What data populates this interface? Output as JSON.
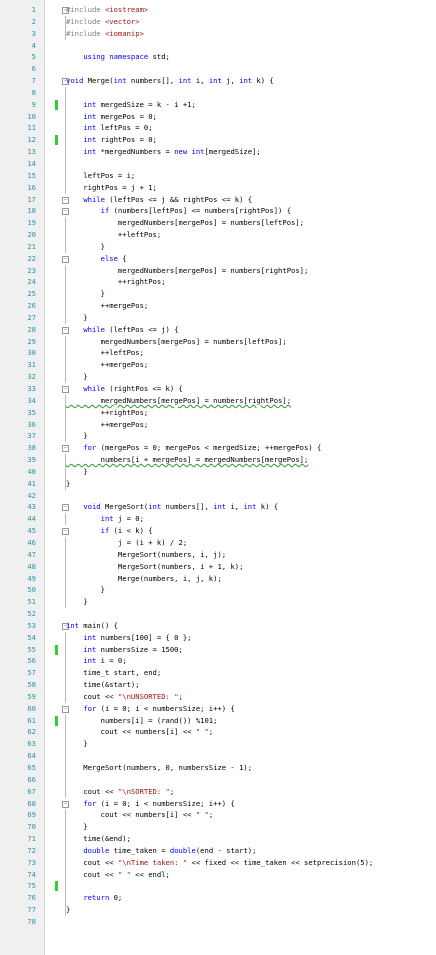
{
  "editor": {
    "lines": [
      {
        "n": "1",
        "text": "#include <iostream>",
        "fold": "open"
      },
      {
        "n": "2",
        "text": "#include <vector>",
        "bar": true
      },
      {
        "n": "3",
        "text": "#include <iomanip>",
        "bar": true
      },
      {
        "n": "4",
        "text": ""
      },
      {
        "n": "5",
        "text": "    using namespace std;"
      },
      {
        "n": "6",
        "text": ""
      },
      {
        "n": "7",
        "text": "void Merge(int numbers[], int i, int j, int k) {",
        "fold": "open"
      },
      {
        "n": "8",
        "text": "",
        "bar": true
      },
      {
        "n": "9",
        "text": "    int mergedSize = k - i +1;",
        "bar": true,
        "changed": true
      },
      {
        "n": "10",
        "text": "    int mergePos = 0;",
        "bar": true
      },
      {
        "n": "11",
        "text": "    int leftPos = 0;",
        "bar": true
      },
      {
        "n": "12",
        "text": "    int rightPos = 0;",
        "bar": true,
        "changed": true
      },
      {
        "n": "13",
        "text": "    int *mergedNumbers = new int[mergedSize];",
        "bar": true
      },
      {
        "n": "14",
        "text": "",
        "bar": true
      },
      {
        "n": "15",
        "text": "    leftPos = i;",
        "bar": true
      },
      {
        "n": "16",
        "text": "    rightPos = j + 1;",
        "bar": true
      },
      {
        "n": "17",
        "text": "    while (leftPos <= j && rightPos <= k) {",
        "fold": "open"
      },
      {
        "n": "18",
        "text": "        if (numbers[leftPos] <= numbers[rightPos]) {",
        "fold": "open"
      },
      {
        "n": "19",
        "text": "            mergedNumbers[mergePos] = numbers[leftPos];",
        "bar": true
      },
      {
        "n": "20",
        "text": "            ++leftPos;",
        "bar": true
      },
      {
        "n": "21",
        "text": "        }",
        "bar": true
      },
      {
        "n": "22",
        "text": "        else {",
        "fold": "open"
      },
      {
        "n": "23",
        "text": "            mergedNumbers[mergePos] = numbers[rightPos];",
        "bar": true
      },
      {
        "n": "24",
        "text": "            ++rightPos;",
        "bar": true
      },
      {
        "n": "25",
        "text": "        }",
        "bar": true
      },
      {
        "n": "26",
        "text": "        ++mergePos;",
        "bar": true
      },
      {
        "n": "27",
        "text": "    }",
        "bar": true
      },
      {
        "n": "28",
        "text": "    while (leftPos <= j) {",
        "fold": "open"
      },
      {
        "n": "29",
        "text": "        mergedNumbers[mergePos] = numbers[leftPos];",
        "bar": true
      },
      {
        "n": "30",
        "text": "        ++leftPos;",
        "bar": true
      },
      {
        "n": "31",
        "text": "        ++mergePos;",
        "bar": true
      },
      {
        "n": "32",
        "text": "    }",
        "bar": true
      },
      {
        "n": "33",
        "text": "    while (rightPos <= k) {",
        "fold": "open"
      },
      {
        "n": "34",
        "text": "        mergedNumbers[mergePos] = numbers[rightPos];",
        "bar": true,
        "squiggle": true
      },
      {
        "n": "35",
        "text": "        ++rightPos;",
        "bar": true
      },
      {
        "n": "36",
        "text": "        ++mergePos;",
        "bar": true
      },
      {
        "n": "37",
        "text": "    }",
        "bar": true
      },
      {
        "n": "38",
        "text": "    for (mergePos = 0; mergePos < mergedSize; ++mergePos) {",
        "fold": "open"
      },
      {
        "n": "39",
        "text": "        numbers[i + mergePos] = mergedNumbers[mergePos];",
        "bar": true,
        "squiggle": true
      },
      {
        "n": "40",
        "text": "    }",
        "bar": true
      },
      {
        "n": "41",
        "text": "}",
        "bar": true
      },
      {
        "n": "42",
        "text": ""
      },
      {
        "n": "43",
        "text": "    void MergeSort(int numbers[], int i, int k) {",
        "fold": "open"
      },
      {
        "n": "44",
        "text": "        int j = 0;",
        "bar": true
      },
      {
        "n": "45",
        "text": "        if (i < k) {",
        "fold": "open"
      },
      {
        "n": "46",
        "text": "            j = (i + k) / 2;",
        "bar": true
      },
      {
        "n": "47",
        "text": "            MergeSort(numbers, i, j);",
        "bar": true
      },
      {
        "n": "48",
        "text": "            MergeSort(numbers, i + 1, k);",
        "bar": true
      },
      {
        "n": "49",
        "text": "            Merge(numbers, i, j, k);",
        "bar": true
      },
      {
        "n": "50",
        "text": "        }",
        "bar": true
      },
      {
        "n": "51",
        "text": "    }",
        "bar": true
      },
      {
        "n": "52",
        "text": ""
      },
      {
        "n": "53",
        "text": "int main() {",
        "fold": "open"
      },
      {
        "n": "54",
        "text": "    int numbers[100] = { 0 };",
        "bar": true
      },
      {
        "n": "55",
        "text": "    int numbersSize = 1500;",
        "bar": true,
        "changed": true
      },
      {
        "n": "56",
        "text": "    int i = 0;",
        "bar": true
      },
      {
        "n": "57",
        "text": "    time_t start, end;",
        "bar": true
      },
      {
        "n": "58",
        "text": "    time(&start);",
        "bar": true
      },
      {
        "n": "59",
        "text": "    cout << \"\\nUNSORTED: \";",
        "bar": true
      },
      {
        "n": "60",
        "text": "    for (i = 0; i < numbersSize; i++) {",
        "fold": "open"
      },
      {
        "n": "61",
        "text": "        numbers[i] = (rand()) %101;",
        "bar": true,
        "changed": true
      },
      {
        "n": "62",
        "text": "        cout << numbers[i] << \" \";",
        "bar": true
      },
      {
        "n": "63",
        "text": "    }",
        "bar": true
      },
      {
        "n": "64",
        "text": "",
        "bar": true
      },
      {
        "n": "65",
        "text": "    MergeSort(numbers, 0, numbersSize - 1);",
        "bar": true
      },
      {
        "n": "66",
        "text": "",
        "bar": true
      },
      {
        "n": "67",
        "text": "    cout << \"\\nSORTED: \";",
        "bar": true
      },
      {
        "n": "68",
        "text": "    for (i = 0; i < numbersSize; i++) {",
        "fold": "open"
      },
      {
        "n": "69",
        "text": "        cout << numbers[i] << \" \";",
        "bar": true
      },
      {
        "n": "70",
        "text": "    }",
        "bar": true
      },
      {
        "n": "71",
        "text": "    time(&end);",
        "bar": true
      },
      {
        "n": "72",
        "text": "    double time_taken = double(end - start);",
        "bar": true
      },
      {
        "n": "73",
        "text": "    cout << \"\\nTime taken: \" << fixed << time_taken << setprecision(5);",
        "bar": true
      },
      {
        "n": "74",
        "text": "    cout << \" \" << endl;",
        "bar": true
      },
      {
        "n": "75",
        "text": "",
        "bar": true,
        "changed": true
      },
      {
        "n": "76",
        "text": "    return 0;",
        "bar": true
      },
      {
        "n": "77",
        "text": "}",
        "bar": true
      },
      {
        "n": "78",
        "text": ""
      }
    ]
  },
  "colors": {
    "keyword": "#0000ff",
    "string": "#a31515",
    "preprocessor": "#808080",
    "include_path": "#a31515",
    "line_number": "#2b91af",
    "change_marker": "#33cc33"
  }
}
